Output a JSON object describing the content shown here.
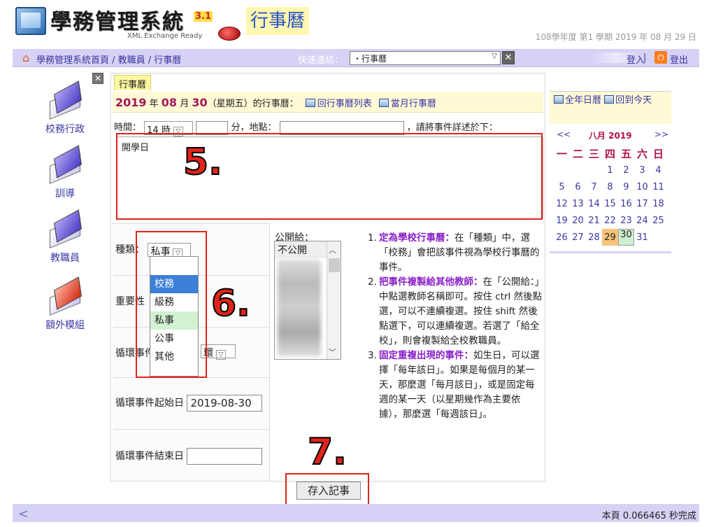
{
  "header": {
    "title": "學務管理系統",
    "version": "3.1",
    "subtitle": "XML Exchange Ready",
    "page_tag": "行事曆",
    "date_line": "108學年度 第1 學期 2019 年 08 月 29 日"
  },
  "nav": {
    "breadcrumb": "學務管理系統首頁 / 教職員 / 行事曆",
    "quick_label": "快速連結：",
    "quick_value": "・行事曆",
    "login": "登入",
    "separator": "|",
    "logout": "登出"
  },
  "sidebar": {
    "items": [
      {
        "label": "校務行政"
      },
      {
        "label": "訓導"
      },
      {
        "label": "教職員"
      },
      {
        "label": "額外模組"
      }
    ]
  },
  "main": {
    "tab": "行事曆",
    "title": {
      "year": "2019",
      "t1": " 年 ",
      "month": "08",
      "t2": " 月 ",
      "day": "30",
      "t3": "（星期五）的行事曆：",
      "back_list": "回行事曆列表",
      "month_view": "當月行事曆"
    },
    "row1": {
      "time_label": "時間：",
      "hour": "14 時",
      "min_label": "分，地點：",
      "hint": "，請將事件詳述於下："
    },
    "description": "開學日",
    "type_label": "種類：",
    "type_value": "私事",
    "type_options": [
      "",
      "校務",
      "級務",
      "私事",
      "公事",
      "其他"
    ],
    "importance_label": "重要性",
    "repeat_label": "循環事件",
    "repeat_partial": "環",
    "start_label": "循環事件起始日",
    "start_value": "2019-08-30",
    "end_label": "循環事件結束日",
    "end_value": "",
    "public_label": "公開給：",
    "public_first": "不公開",
    "save_label": "存入記事"
  },
  "notes": [
    {
      "num": "1.",
      "head": "定為學校行事曆：",
      "body": "在「種類」中，選「校務」會把該事件視為學校行事曆的事件。"
    },
    {
      "num": "2.",
      "head": "把事件複製給其他教師：",
      "body": "在「公開給：」中點選教師名稱即可。按住 ctrl 然後點選，可以不連續複選。按住 shift 然後點選下，可以連續複選。若選了「給全校」，則會複製給全校教職員。"
    },
    {
      "num": "3.",
      "head": "固定重複出現的事件：",
      "body": "如生日，可以選擇「每年該日」。如果是每個月的某一天，那麼選「每月該日」，或是固定每週的某一天（以星期幾作為主要依據），那麼選「每週該日」。"
    }
  ],
  "steps": {
    "s5": "5.",
    "s6": "6.",
    "s7": "7."
  },
  "calendar": {
    "year_view": "全年日曆",
    "today": "回到今天",
    "prev": "<<",
    "month": "八月 2019",
    "next": ">>",
    "weekdays": [
      "一",
      "二",
      "三",
      "四",
      "五",
      "六",
      "日"
    ],
    "weeks": [
      [
        "",
        "",
        "",
        "1",
        "2",
        "3",
        "4"
      ],
      [
        "5",
        "6",
        "7",
        "8",
        "9",
        "10",
        "11"
      ],
      [
        "12",
        "13",
        "14",
        "15",
        "16",
        "17",
        "18"
      ],
      [
        "19",
        "20",
        "21",
        "22",
        "23",
        "24",
        "25"
      ],
      [
        "26",
        "27",
        "28",
        "29",
        "30",
        "31",
        ""
      ]
    ],
    "today_day": "29",
    "selected_day": "30"
  },
  "footer": {
    "status": "本頁 0.066465 秒完成"
  },
  "colors": {
    "accent": "#d6d2f5",
    "highlight": "#e0241b",
    "link": "#3a37a0"
  }
}
